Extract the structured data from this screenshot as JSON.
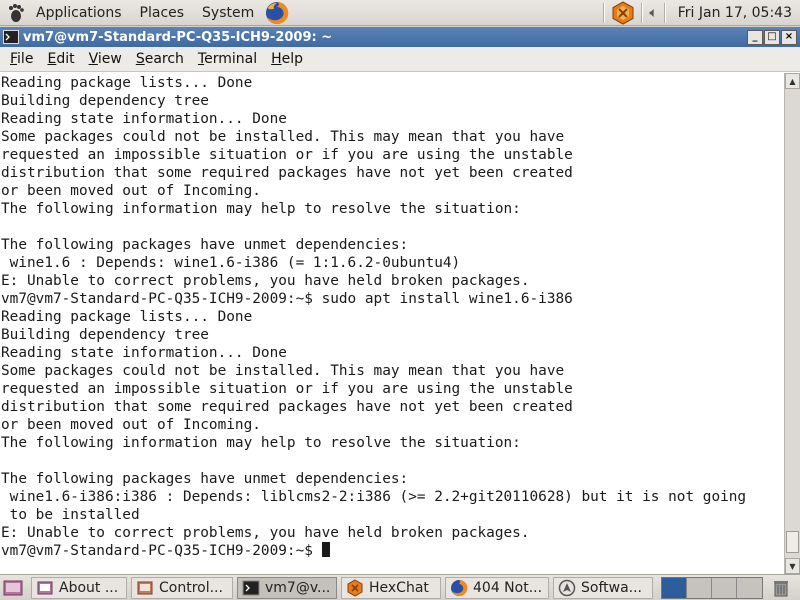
{
  "top_panel": {
    "menus": [
      "Applications",
      "Places",
      "System"
    ],
    "clock": "Fri Jan 17, 05:43"
  },
  "window": {
    "title": "vm7@vm7-Standard-PC-Q35-ICH9-2009: ~",
    "controls": [
      "_",
      "□",
      "×"
    ]
  },
  "menubar": {
    "items": [
      {
        "label": "File",
        "underline": "F",
        "rest": "ile"
      },
      {
        "label": "Edit",
        "underline": "E",
        "rest": "dit"
      },
      {
        "label": "View",
        "underline": "V",
        "rest": "iew"
      },
      {
        "label": "Search",
        "underline": "S",
        "rest": "earch"
      },
      {
        "label": "Terminal",
        "underline": "T",
        "rest": "erminal"
      },
      {
        "label": "Help",
        "underline": "H",
        "rest": "elp"
      }
    ]
  },
  "terminal": {
    "lines": [
      "Reading package lists... Done",
      "Building dependency tree",
      "Reading state information... Done",
      "Some packages could not be installed. This may mean that you have",
      "requested an impossible situation or if you are using the unstable",
      "distribution that some required packages have not yet been created",
      "or been moved out of Incoming.",
      "The following information may help to resolve the situation:",
      "",
      "The following packages have unmet dependencies:",
      " wine1.6 : Depends: wine1.6-i386 (= 1:1.6.2-0ubuntu4)",
      "E: Unable to correct problems, you have held broken packages.",
      "vm7@vm7-Standard-PC-Q35-ICH9-2009:~$ sudo apt install wine1.6-i386",
      "Reading package lists... Done",
      "Building dependency tree",
      "Reading state information... Done",
      "Some packages could not be installed. This may mean that you have",
      "requested an impossible situation or if you are using the unstable",
      "distribution that some required packages have not yet been created",
      "or been moved out of Incoming.",
      "The following information may help to resolve the situation:",
      "",
      "The following packages have unmet dependencies:",
      " wine1.6-i386:i386 : Depends: liblcms2-2:i386 (>= 2.2+git20110628) but it is not going",
      " to be installed",
      "E: Unable to correct problems, you have held broken packages."
    ],
    "prompt": "vm7@vm7-Standard-PC-Q35-ICH9-2009:~$ "
  },
  "taskbar": {
    "tasks": [
      {
        "label": "About ...",
        "icon": "about-icon"
      },
      {
        "label": "Control...",
        "icon": "control-center-icon"
      },
      {
        "label": "vm7@v...",
        "icon": "terminal-icon",
        "active": true
      },
      {
        "label": "HexChat",
        "icon": "hexchat-icon"
      },
      {
        "label": "404 Not...",
        "icon": "firefox-icon"
      },
      {
        "label": "Softwa...",
        "icon": "software-icon"
      }
    ]
  },
  "colors": {
    "title_bar": "#3e6aa3",
    "active_workspace": "#2d5d9b"
  }
}
